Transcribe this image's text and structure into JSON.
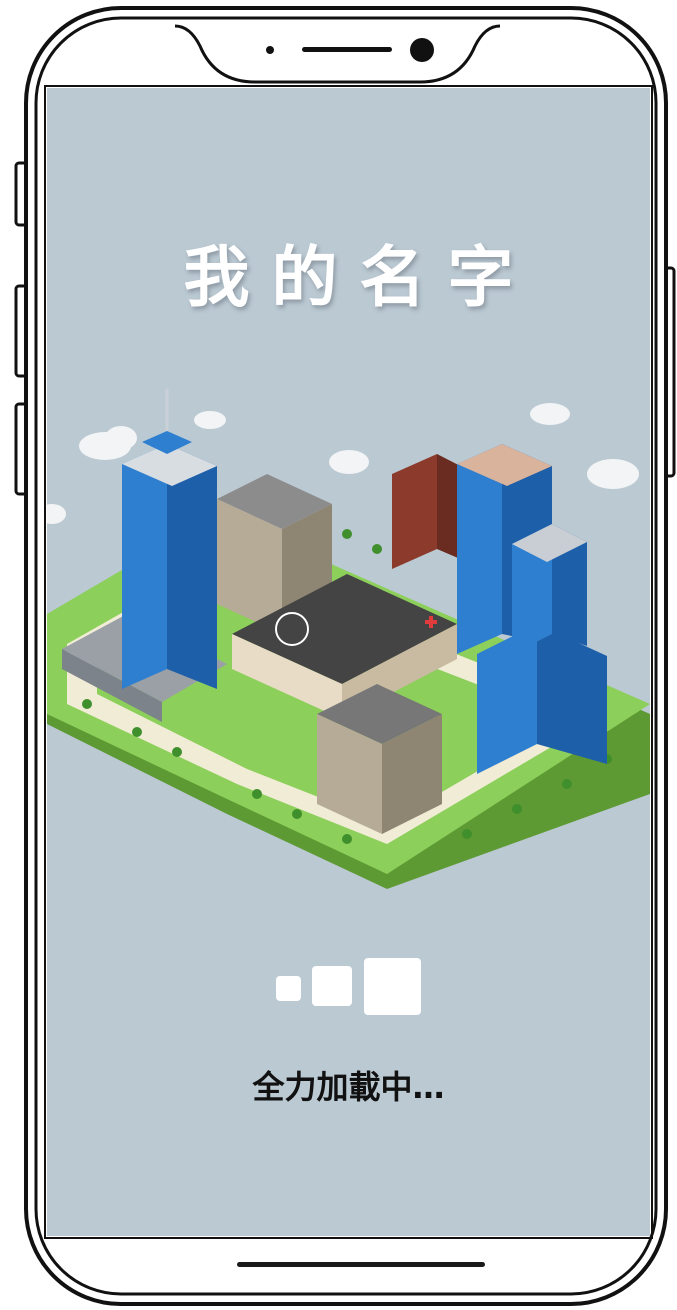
{
  "app": {
    "title": "我的名字",
    "loading_text": "全力加載中…"
  },
  "loader": {
    "squares": 3
  },
  "colors": {
    "screen_bg": "#bbc9d3",
    "title": "#ffffff",
    "loading_text": "#111111",
    "grass": "#8ccf5a",
    "building_blue": "#2f7fd0"
  },
  "icons": [
    "camera-icon",
    "speaker-icon",
    "helipad-icon",
    "cloud-icon",
    "tree-icon"
  ]
}
